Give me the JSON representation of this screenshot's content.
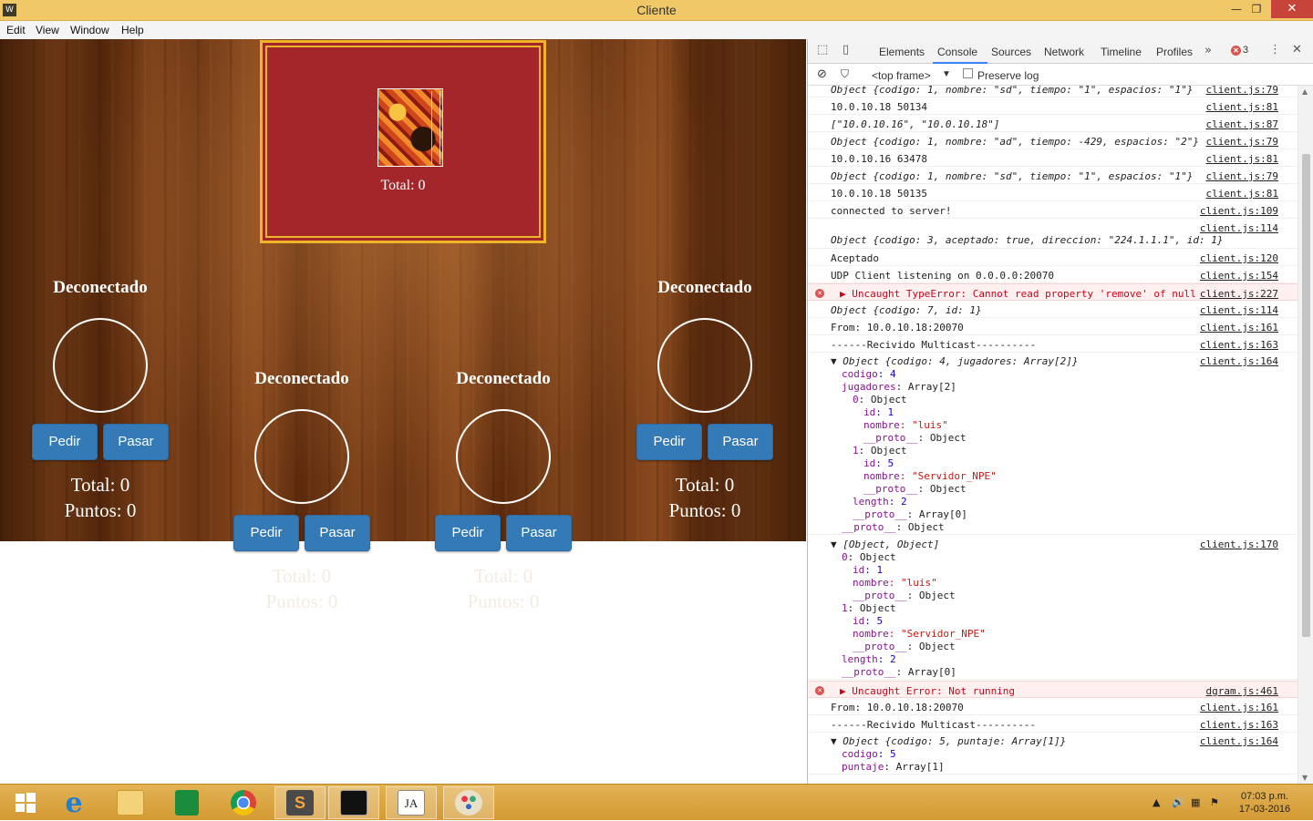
{
  "window": {
    "title": "Cliente",
    "minimize": "—",
    "restore": "❐",
    "close": "✕"
  },
  "menu": [
    "Edit",
    "View",
    "Window",
    "Help"
  ],
  "dealer": {
    "total": "Total: 0"
  },
  "players": [
    {
      "name": "Deconectado",
      "pedir": "Pedir",
      "pasar": "Pasar",
      "total": "Total: 0",
      "puntos": "Puntos: 0"
    },
    {
      "name": "Deconectado",
      "pedir": "Pedir",
      "pasar": "Pasar",
      "total": "Total: 0",
      "puntos": "Puntos: 0"
    },
    {
      "name": "Deconectado",
      "pedir": "Pedir",
      "pasar": "Pasar",
      "total": "Total: 0",
      "puntos": "Puntos: 0"
    },
    {
      "name": "Deconectado",
      "pedir": "Pedir",
      "pasar": "Pasar",
      "total": "Total: 0",
      "puntos": "Puntos: 0"
    }
  ],
  "devtools": {
    "tabs": [
      "Elements",
      "Console",
      "Sources",
      "Network",
      "Timeline",
      "Profiles"
    ],
    "more": "»",
    "error_count": "3",
    "frame_select": "<top frame>",
    "preserve_log": "Preserve log",
    "console": [
      {
        "msg": "Object {codigo: 1, nombre: \"sd\", tiempo: \"1\", espacios: \"1\"}",
        "src": "client.js:79",
        "type": "obj"
      },
      {
        "msg": "10.0.10.18 50134",
        "src": "client.js:81",
        "type": "log"
      },
      {
        "msg": "[\"10.0.10.16\", \"10.0.10.18\"]",
        "src": "client.js:87",
        "type": "arr"
      },
      {
        "msg": "Object {codigo: 1, nombre: \"ad\", tiempo: -429, espacios: \"2\"}",
        "src": "client.js:79",
        "type": "obj"
      },
      {
        "msg": "10.0.10.16 63478",
        "src": "client.js:81",
        "type": "log"
      },
      {
        "msg": "Object {codigo: 1, nombre: \"sd\", tiempo: \"1\", espacios: \"1\"}",
        "src": "client.js:79",
        "type": "obj"
      },
      {
        "msg": "10.0.10.18 50135",
        "src": "client.js:81",
        "type": "log"
      },
      {
        "msg": "connected to server!",
        "src": "client.js:109",
        "type": "log"
      },
      {
        "msg": "Object {codigo: 3, aceptado: true, direccion: \"224.1.1.1\", id: 1}",
        "src": "client.js:114",
        "type": "obj"
      },
      {
        "msg": "Aceptado",
        "src": "client.js:120",
        "type": "log"
      },
      {
        "msg": "UDP Client listening on 0.0.0.0:20070",
        "src": "client.js:154",
        "type": "log"
      },
      {
        "msg": "Uncaught TypeError: Cannot read property 'remove' of null",
        "src": "client.js:227",
        "type": "error"
      },
      {
        "msg": "Object {codigo: 7, id: 1}",
        "src": "client.js:114",
        "type": "obj"
      },
      {
        "msg": "From: 10.0.10.18:20070",
        "src": "client.js:161",
        "type": "log"
      },
      {
        "msg": "------Recivido Multicast----------",
        "src": "client.js:163",
        "type": "log"
      }
    ],
    "tree1": {
      "head": "Object {codigo: 4, jugadores: Array[2]}",
      "src": "client.js:164",
      "lines": [
        "codigo: 4",
        "jugadores: Array[2]",
        "0: Object",
        "id: 1",
        "nombre: \"luis\"",
        "__proto__: Object",
        "1: Object",
        "id: 5",
        "nombre: \"Servidor_NPE\"",
        "__proto__: Object",
        "length: 2",
        "__proto__: Array[0]",
        "__proto__: Object"
      ]
    },
    "tree2": {
      "head": "[Object, Object]",
      "src": "client.js:170",
      "lines": [
        "0: Object",
        "id: 1",
        "nombre: \"luis\"",
        "__proto__: Object",
        "1: Object",
        "id: 5",
        "nombre: \"Servidor_NPE\"",
        "__proto__: Object",
        "length: 2",
        "__proto__: Array[0]"
      ]
    },
    "tail": [
      {
        "msg": "Uncaught Error: Not running",
        "src": "dgram.js:461",
        "type": "error"
      },
      {
        "msg": "From: 10.0.10.18:20070",
        "src": "client.js:161",
        "type": "log"
      },
      {
        "msg": "------Recivido Multicast----------",
        "src": "client.js:163",
        "type": "log"
      }
    ],
    "tree3": {
      "head": "Object {codigo: 5, puntaje: Array[1]}",
      "src": "client.js:164",
      "lines": [
        "codigo: 5",
        "puntaje: Array[1]"
      ]
    }
  },
  "taskbar": {
    "clock_time": "07:03 p.m.",
    "clock_date": "17-03-2016"
  }
}
